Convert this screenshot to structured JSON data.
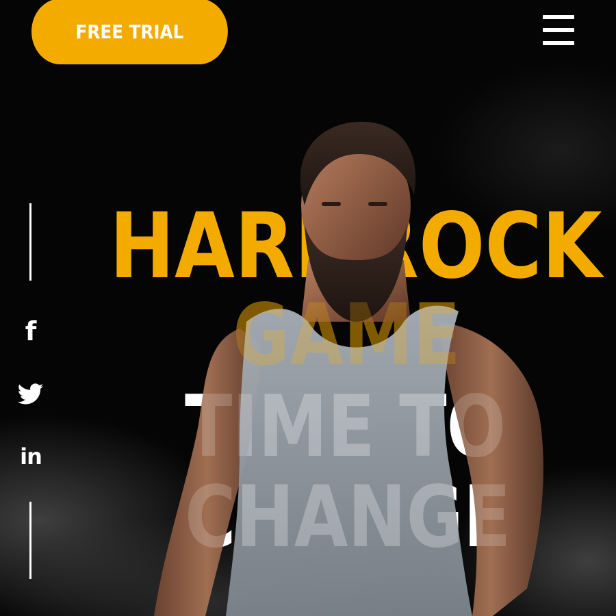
{
  "header": {
    "cta_label": "FREE TRIAL",
    "menu_icon": "hamburger-menu-icon"
  },
  "social": {
    "items": [
      {
        "name": "facebook",
        "icon": "facebook-icon",
        "glyph": "f"
      },
      {
        "name": "twitter",
        "icon": "twitter-icon"
      },
      {
        "name": "linkedin",
        "icon": "linkedin-icon",
        "glyph": "in"
      }
    ]
  },
  "hero": {
    "line1": "HARDROCK",
    "line2": "GAME",
    "line3": "TIME TO",
    "line4": "CHANGE"
  },
  "colors": {
    "accent": "#f3ab00",
    "background": "#050505",
    "text": "#ffffff"
  }
}
